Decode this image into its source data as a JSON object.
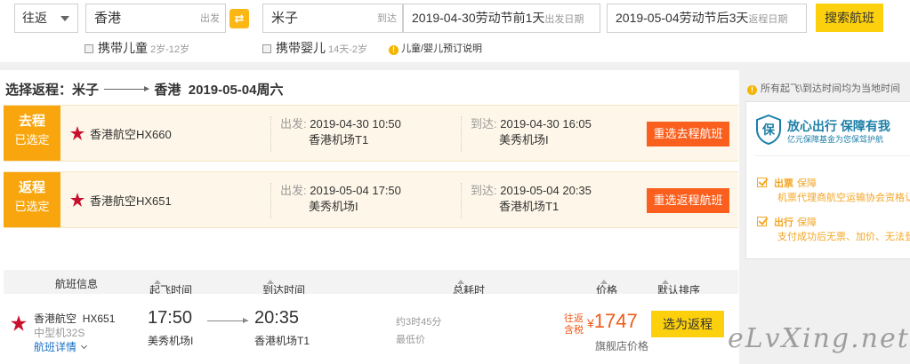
{
  "search": {
    "trip_type": "往返",
    "from_city": "香港",
    "from_hint": "出发",
    "to_city": "米子",
    "to_hint": "到达",
    "swap_icon": "⇄",
    "depart_date": "2019-04-30劳动节前1天",
    "depart_hint": "出发日期",
    "return_date": "2019-05-04劳动节后3天",
    "return_hint": "返程日期",
    "search_label": "搜索航班",
    "child_label": "携带儿童",
    "child_sub": "2岁-12岁",
    "infant_label": "携带婴儿",
    "infant_sub": "14天-2岁",
    "note_label": "儿童/婴儿预订说明"
  },
  "selection": {
    "title_prefix": "选择返程：",
    "from": "米子",
    "to": "香港",
    "date": "2019-05-04周六"
  },
  "legs": [
    {
      "tag_line1": "去程",
      "tag_line2": "已选定",
      "airline": "香港航空HX660",
      "dep_label": "出发:",
      "dep_time": "2019-04-30 10:50",
      "dep_airport": "香港机场T1",
      "arr_label": "到达:",
      "arr_time": "2019-04-30 16:05",
      "arr_airport": "美秀机场I",
      "button": "重选去程航班"
    },
    {
      "tag_line1": "返程",
      "tag_line2": "已选定",
      "airline": "香港航空HX651",
      "dep_label": "出发:",
      "dep_time": "2019-05-04 17:50",
      "dep_airport": "美秀机场I",
      "arr_label": "到达:",
      "arr_time": "2019-05-04 20:35",
      "arr_airport": "香港机场T1",
      "button": "重选返程航班"
    }
  ],
  "list_header": {
    "info": "航班信息",
    "dep_time": "起飞时间",
    "arr_time": "到达时间",
    "duration": "总耗时",
    "price": "价格",
    "sort": "默认排序"
  },
  "flight": {
    "airline": "香港航空",
    "flight_no": "HX651",
    "model": "中型机32S",
    "detail": "航班详情",
    "dep_time": "17:50",
    "dep_airport": "美秀机场I",
    "arr_time": "20:35",
    "arr_airport": "香港机场T1",
    "duration": "约3时45分",
    "lowest": "最低价",
    "tax_line1": "往返",
    "tax_line2": "含税",
    "currency": "¥",
    "price": "1747",
    "price_note": "旗舰店价格",
    "choose_label": "选为返程"
  },
  "side": {
    "notice": "所有起飞\\到达时间均为当地时间",
    "assure_title": "放心出行 保障有我",
    "assure_sub": "亿元保障基金为您保驾护航",
    "item1_key": "出票",
    "item1_val": "保障",
    "item1_desc": "机票代理商航空运输协会资格认证",
    "item2_key": "出行",
    "item2_val": "保障",
    "item2_desc": "支付成功后无票、加价、无法登机"
  },
  "watermark": "eLvXing.net",
  "colors": {
    "accent_yellow": "#fcd00d",
    "tag_orange": "#f9a60e",
    "button_red": "#fa5f1d",
    "price_orange": "#f05a1a",
    "airline_red": "#c8102e"
  }
}
